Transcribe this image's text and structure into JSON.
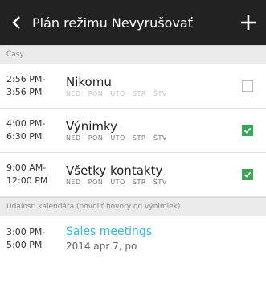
{
  "header": {
    "title": "Plán režimu Nevyrušovať",
    "back_icon": "chevron-left-icon",
    "add_icon": "plus-icon"
  },
  "section_times": {
    "label": "Časy"
  },
  "rules": [
    {
      "start": "2:56 PM-",
      "end": "3:56 PM",
      "name": "Nikomu",
      "days": [
        "NED",
        "PON",
        "UTO",
        "STR",
        "ŠTV"
      ],
      "days_active": false,
      "checked": false
    },
    {
      "start": "4:00 PM-",
      "end": "6:30 PM",
      "name": "Výnimky",
      "days": [
        "NED",
        "PON",
        "UTO",
        "STR",
        "ŠTV"
      ],
      "days_active": true,
      "checked": true
    },
    {
      "start": "9:00 AM-",
      "end": "12:00 PM",
      "name": "Všetky kontakty",
      "days": [
        "NED",
        "PON",
        "UTO",
        "STR",
        "ŠTV"
      ],
      "days_active": true,
      "checked": true
    }
  ],
  "section_events": {
    "label": "Udalosti kalendára (povoliť hovory od výnimiek)"
  },
  "events": [
    {
      "start": "3:00 PM-",
      "end": "5:00 PM",
      "title": "Sales meetings",
      "date": "2014 apr 7, po"
    }
  ],
  "colors": {
    "header_bg": "#222222",
    "check_green": "#3aa557",
    "event_title": "#3ab8df"
  }
}
